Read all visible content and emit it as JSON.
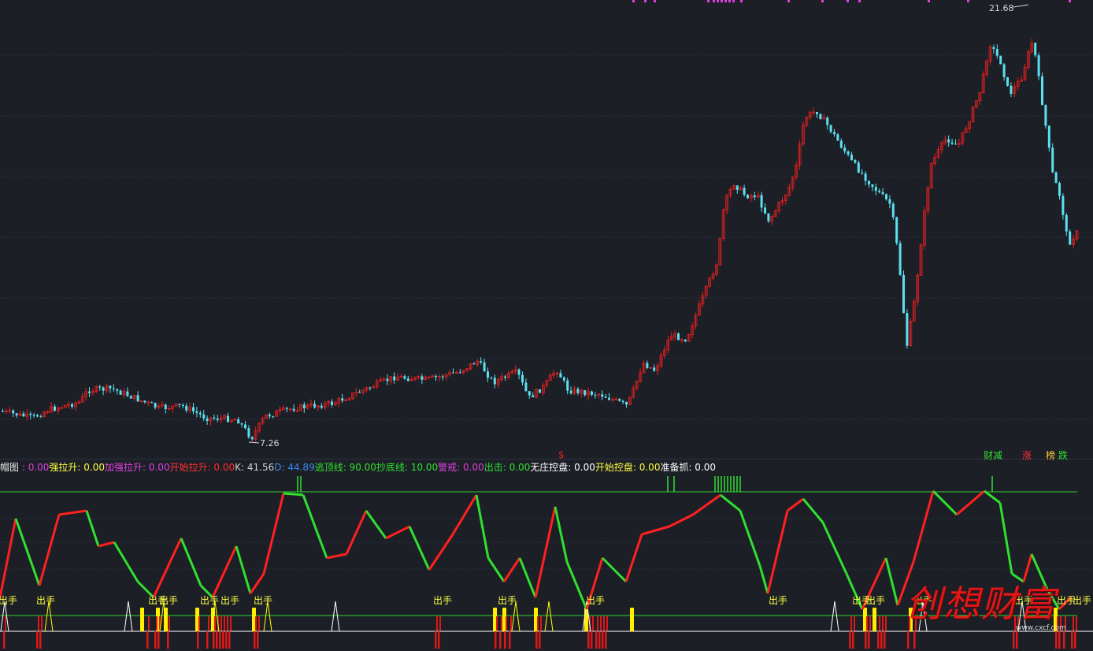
{
  "price_chart": {
    "high_label": "21.68",
    "low_label": "7.26",
    "marker": "$",
    "grid_color": "#2e3a4c",
    "up_color": "#e02020",
    "down_color": "#5ce0f0"
  },
  "legend": {
    "title": "帽图",
    "items": [
      {
        "label": "",
        "value": "0.00",
        "color": "#e040e0"
      },
      {
        "label": "强拉升",
        "value": "0.00",
        "color": "#ffff40"
      },
      {
        "label": "加强拉升",
        "value": "0.00",
        "color": "#e040e0"
      },
      {
        "label": "开始拉升",
        "value": "0.00",
        "color": "#ff3030"
      },
      {
        "label": "K",
        "value": "41.56",
        "color": "#d0d0d0"
      },
      {
        "label": "D",
        "value": "44.89",
        "color": "#3a8af0"
      },
      {
        "label": "逃顶线",
        "value": "90.00",
        "color": "#30e030"
      },
      {
        "label": "抄底线",
        "value": "10.00",
        "color": "#30e030"
      },
      {
        "label": "警戒",
        "value": "0.00",
        "color": "#e040e0"
      },
      {
        "label": "出击",
        "value": "0.00",
        "color": "#30e030"
      },
      {
        "label": "无庄控盘",
        "value": "0.00",
        "color": "#ffffff"
      },
      {
        "label": "开始控盘",
        "value": "0.00",
        "color": "#ffff40"
      },
      {
        "label": "准备抓",
        "value": "0.00",
        "color": "#ffffff"
      }
    ]
  },
  "tags": {
    "t1": "财减",
    "t2": "涨",
    "t3": "榜",
    "t4": "跌"
  },
  "signal_label": "出手",
  "watermark": {
    "text": "创想财富",
    "url": "www.cxcf.com"
  }
}
